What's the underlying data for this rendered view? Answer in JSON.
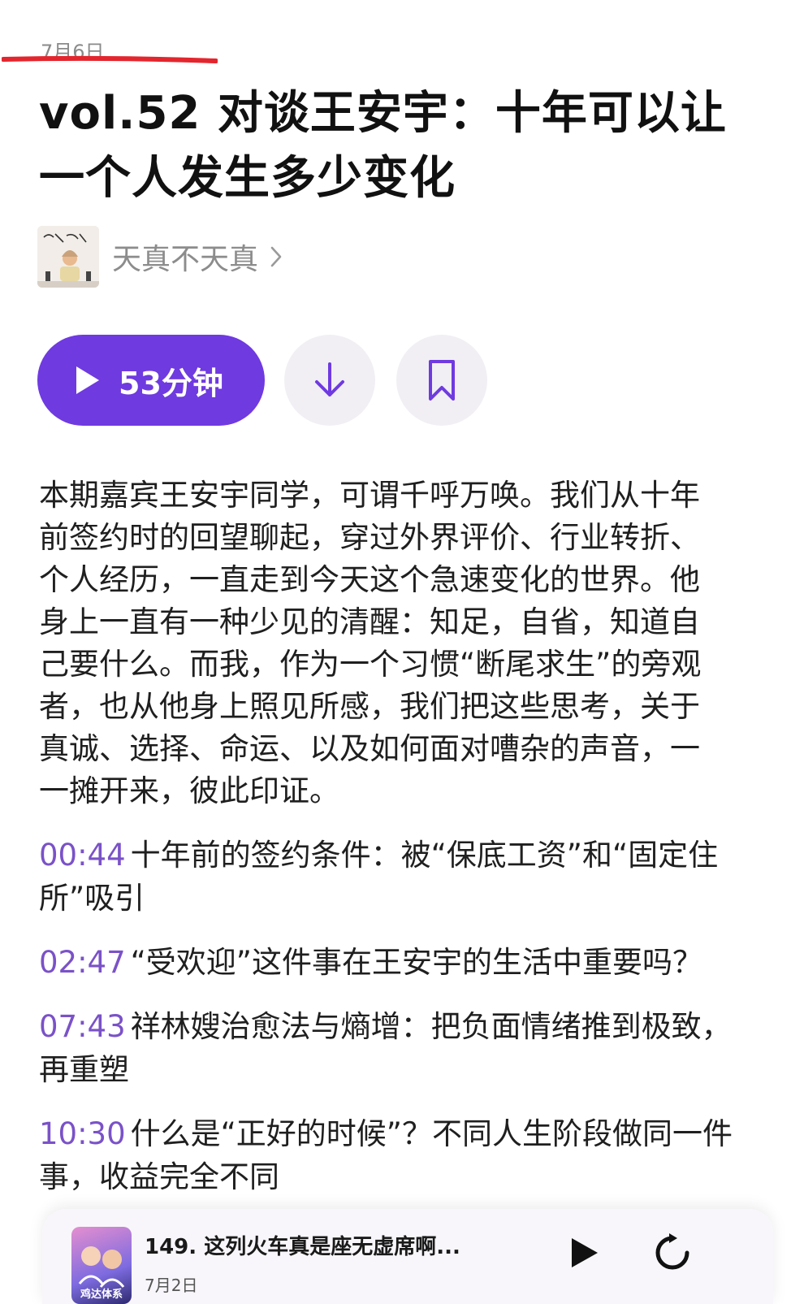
{
  "episode": {
    "date": "7月6日",
    "title": "vol.52 对谈王安宇：十年可以让一个人发生多少变化",
    "duration_label": "53分钟"
  },
  "channel": {
    "name": "天真不天真",
    "cover_icon": "podcast-cover-icon"
  },
  "actions": {
    "play_icon": "play-icon",
    "download_icon": "download-icon",
    "bookmark_icon": "bookmark-icon",
    "accent_color": "#6f3ae0"
  },
  "description": "本期嘉宾王安宇同学，可谓千呼万唤。我们从十年前签约时的回望聊起，穿过外界评价、行业转折、个人经历，一直走到今天这个急速变化的世界。他身上一直有一种少见的清醒：知足，自省，知道自己要什么。而我，作为一个习惯“断尾求生”的旁观者，也从他身上照见所感，我们把这些思考，关于真诚、选择、命运、以及如何面对嘈杂的声音，一一摊开来，彼此印证。",
  "chapters": [
    {
      "time": "00:44",
      "text": "十年前的签约条件：被“保底工资”和“固定住所”吸引"
    },
    {
      "time": "02:47",
      "text": "“受欢迎”这件事在王安宇的生活中重要吗？"
    },
    {
      "time": "07:43",
      "text": "祥林嫂治愈法与熵增：把负面情绪推到极致，再重塑"
    },
    {
      "time": "10:30",
      "text": "什么是“正好的时候”？不同人生阶段做同一件事，收益完全不同"
    }
  ],
  "mini_player": {
    "title": "149. 这列火车真是座无虚席啊...",
    "date": "7月2日",
    "cover_label": "鸡达体系",
    "play_icon": "play-icon",
    "skip_icon": "skip-forward-icon"
  }
}
